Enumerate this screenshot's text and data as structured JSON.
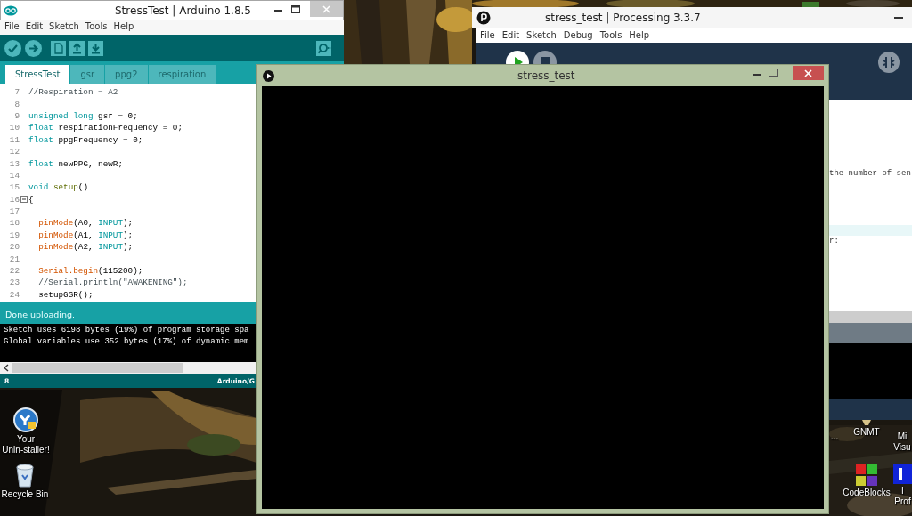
{
  "arduino": {
    "title": "StressTest | Arduino 1.8.5",
    "menu": [
      "File",
      "Edit",
      "Sketch",
      "Tools",
      "Help"
    ],
    "tabs": [
      {
        "label": "StressTest",
        "selected": true
      },
      {
        "label": "gsr",
        "selected": false
      },
      {
        "label": "ppg2",
        "selected": false
      },
      {
        "label": "respiration",
        "selected": false
      }
    ],
    "code": [
      {
        "line": "7",
        "fold": false,
        "tokens": [
          {
            "kind": "comment",
            "text": "//Respiration = A2"
          }
        ]
      },
      {
        "line": "8",
        "fold": false
      },
      {
        "line": "9",
        "fold": false,
        "tokens": [
          {
            "kind": "keyword",
            "text": "unsigned long"
          },
          {
            "kind": "plain",
            "text": " gsr = 0;"
          }
        ]
      },
      {
        "line": "10",
        "fold": false,
        "tokens": [
          {
            "kind": "keyword",
            "text": "float"
          },
          {
            "kind": "plain",
            "text": " respirationFrequency = 0;"
          }
        ]
      },
      {
        "line": "11",
        "fold": false,
        "tokens": [
          {
            "kind": "keyword",
            "text": "float"
          },
          {
            "kind": "plain",
            "text": " ppgFrequency = 0;"
          }
        ]
      },
      {
        "line": "12",
        "fold": false
      },
      {
        "line": "13",
        "fold": false,
        "tokens": [
          {
            "kind": "keyword",
            "text": "float"
          },
          {
            "kind": "plain",
            "text": " newPPG, newR;"
          }
        ]
      },
      {
        "line": "14",
        "fold": false
      },
      {
        "line": "15",
        "fold": false,
        "tokens": [
          {
            "kind": "keyword",
            "text": "void"
          },
          {
            "kind": "structure",
            "text": " setup"
          },
          {
            "kind": "plain",
            "text": "()"
          }
        ]
      },
      {
        "line": "16",
        "fold": true,
        "tokens": [
          {
            "kind": "plain",
            "text": "{"
          }
        ]
      },
      {
        "line": "17",
        "fold": false
      },
      {
        "line": "18",
        "fold": false,
        "tokens": [
          {
            "kind": "function",
            "text": "  pinMode"
          },
          {
            "kind": "plain",
            "text": "(A0, "
          },
          {
            "kind": "keyword",
            "text": "INPUT"
          },
          {
            "kind": "plain",
            "text": ");"
          }
        ]
      },
      {
        "line": "19",
        "fold": false,
        "tokens": [
          {
            "kind": "function",
            "text": "  pinMode"
          },
          {
            "kind": "plain",
            "text": "(A1, "
          },
          {
            "kind": "keyword",
            "text": "INPUT"
          },
          {
            "kind": "plain",
            "text": ");"
          }
        ]
      },
      {
        "line": "20",
        "fold": false,
        "tokens": [
          {
            "kind": "function",
            "text": "  pinMode"
          },
          {
            "kind": "plain",
            "text": "(A2, "
          },
          {
            "kind": "keyword",
            "text": "INPUT"
          },
          {
            "kind": "plain",
            "text": ");"
          }
        ]
      },
      {
        "line": "21",
        "fold": false
      },
      {
        "line": "22",
        "fold": false,
        "tokens": [
          {
            "kind": "function",
            "text": "  Serial.begin"
          },
          {
            "kind": "plain",
            "text": "(115200);"
          }
        ]
      },
      {
        "line": "23",
        "fold": false,
        "tokens": [
          {
            "kind": "comment",
            "text": "  //Serial.println(\"AWAKENING\");"
          }
        ]
      },
      {
        "line": "24",
        "fold": false,
        "tokens": [
          {
            "kind": "plain",
            "text": "  setupGSR();"
          }
        ]
      }
    ],
    "status": "Done uploading.",
    "console": [
      "Sketch uses 6198 bytes (19%) of program storage spa",
      "Global variables use 352 bytes (17%) of dynamic mem"
    ],
    "footer": {
      "line": "8",
      "board": "Arduino/G"
    }
  },
  "processing": {
    "title": "stress_test | Processing 3.3.7",
    "menu": [
      "File",
      "Edit",
      "Sketch",
      "Debug",
      "Tools",
      "Help"
    ],
    "editor_lines": [
      "the number of sen",
      "r:"
    ]
  },
  "sketch_window": {
    "title": "stress_test"
  },
  "desktop_icons": [
    {
      "kind": "uninstaller",
      "label": [
        "Your",
        "Unin-staller!"
      ]
    },
    {
      "kind": "hidden",
      "label": [
        "..."
      ]
    },
    {
      "kind": "cut-app",
      "label": [
        "GNMT"
      ]
    },
    {
      "kind": "hidden",
      "label": [
        "Mi",
        "Visu"
      ]
    },
    {
      "kind": "recycle-bin",
      "label": [
        "Recycle Bin"
      ]
    },
    {
      "kind": "codeblocks",
      "label": [
        "CodeBlocks"
      ]
    },
    {
      "kind": "blue-app",
      "label": [
        "I",
        "Prof"
      ]
    }
  ]
}
